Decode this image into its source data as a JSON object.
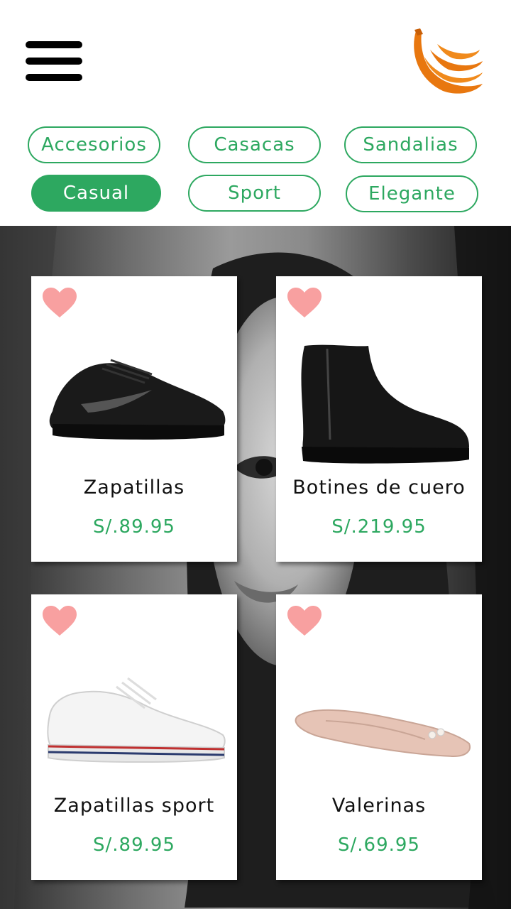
{
  "header": {
    "menu_icon": "hamburger-menu-icon",
    "logo_icon": "banana-logo-icon",
    "logo_color": "#e8770f"
  },
  "categories": [
    {
      "label": "Accesorios",
      "active": false
    },
    {
      "label": "Casacas",
      "active": false
    },
    {
      "label": "Sandalias",
      "active": false
    },
    {
      "label": "Casual",
      "active": true
    },
    {
      "label": "Sport",
      "active": false
    },
    {
      "label": "Elegante",
      "active": false
    }
  ],
  "products": [
    {
      "name": "Zapatillas",
      "price": "S/.89.95",
      "favorite_icon": "heart-icon"
    },
    {
      "name": "Botines de cuero",
      "price": "S/.219.95",
      "favorite_icon": "heart-icon"
    },
    {
      "name": "Zapatillas sport",
      "price": "S/.89.95",
      "favorite_icon": "heart-icon"
    },
    {
      "name": "Valerinas",
      "price": "S/.69.95",
      "favorite_icon": "heart-icon"
    }
  ],
  "colors": {
    "accent": "#2da860",
    "heart": "#f8a0a0",
    "logo": "#e8770f"
  }
}
